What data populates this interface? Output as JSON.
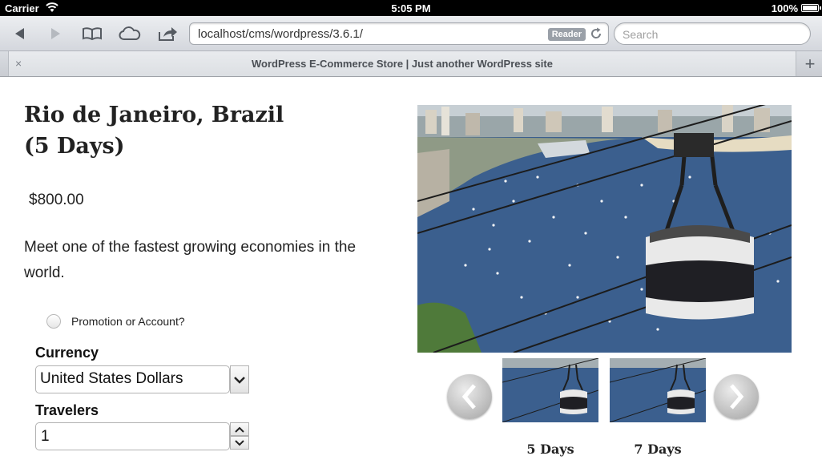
{
  "status_bar": {
    "carrier": "Carrier",
    "time": "5:05 PM",
    "battery": "100%"
  },
  "browser": {
    "url": "localhost/cms/wordpress/3.6.1/",
    "reader_label": "Reader",
    "search_placeholder": "Search",
    "tab_title": "WordPress E-Commerce Store | Just another WordPress site",
    "tab_close": "×",
    "new_tab": "+"
  },
  "product": {
    "title_line1": "Rio de Janeiro, Brazil",
    "title_line2": "(5 Days)",
    "price": "$800.00",
    "description": "Meet one of the fastest growing economies in the world.",
    "promo_label": "Promotion or Account?",
    "currency_label": "Currency",
    "currency_value": "United States Dollars",
    "travelers_label": "Travelers",
    "travelers_value": "1"
  },
  "gallery": {
    "thumbnails": [
      {
        "label": "5 Days"
      },
      {
        "label": "7 Days"
      }
    ]
  },
  "colors": {
    "status_bar_bg": "#000000",
    "toolbar_bg": "#d4d7dd",
    "water_blue": "#3a5f8f",
    "arrow_gray": "#b8b8b8"
  }
}
